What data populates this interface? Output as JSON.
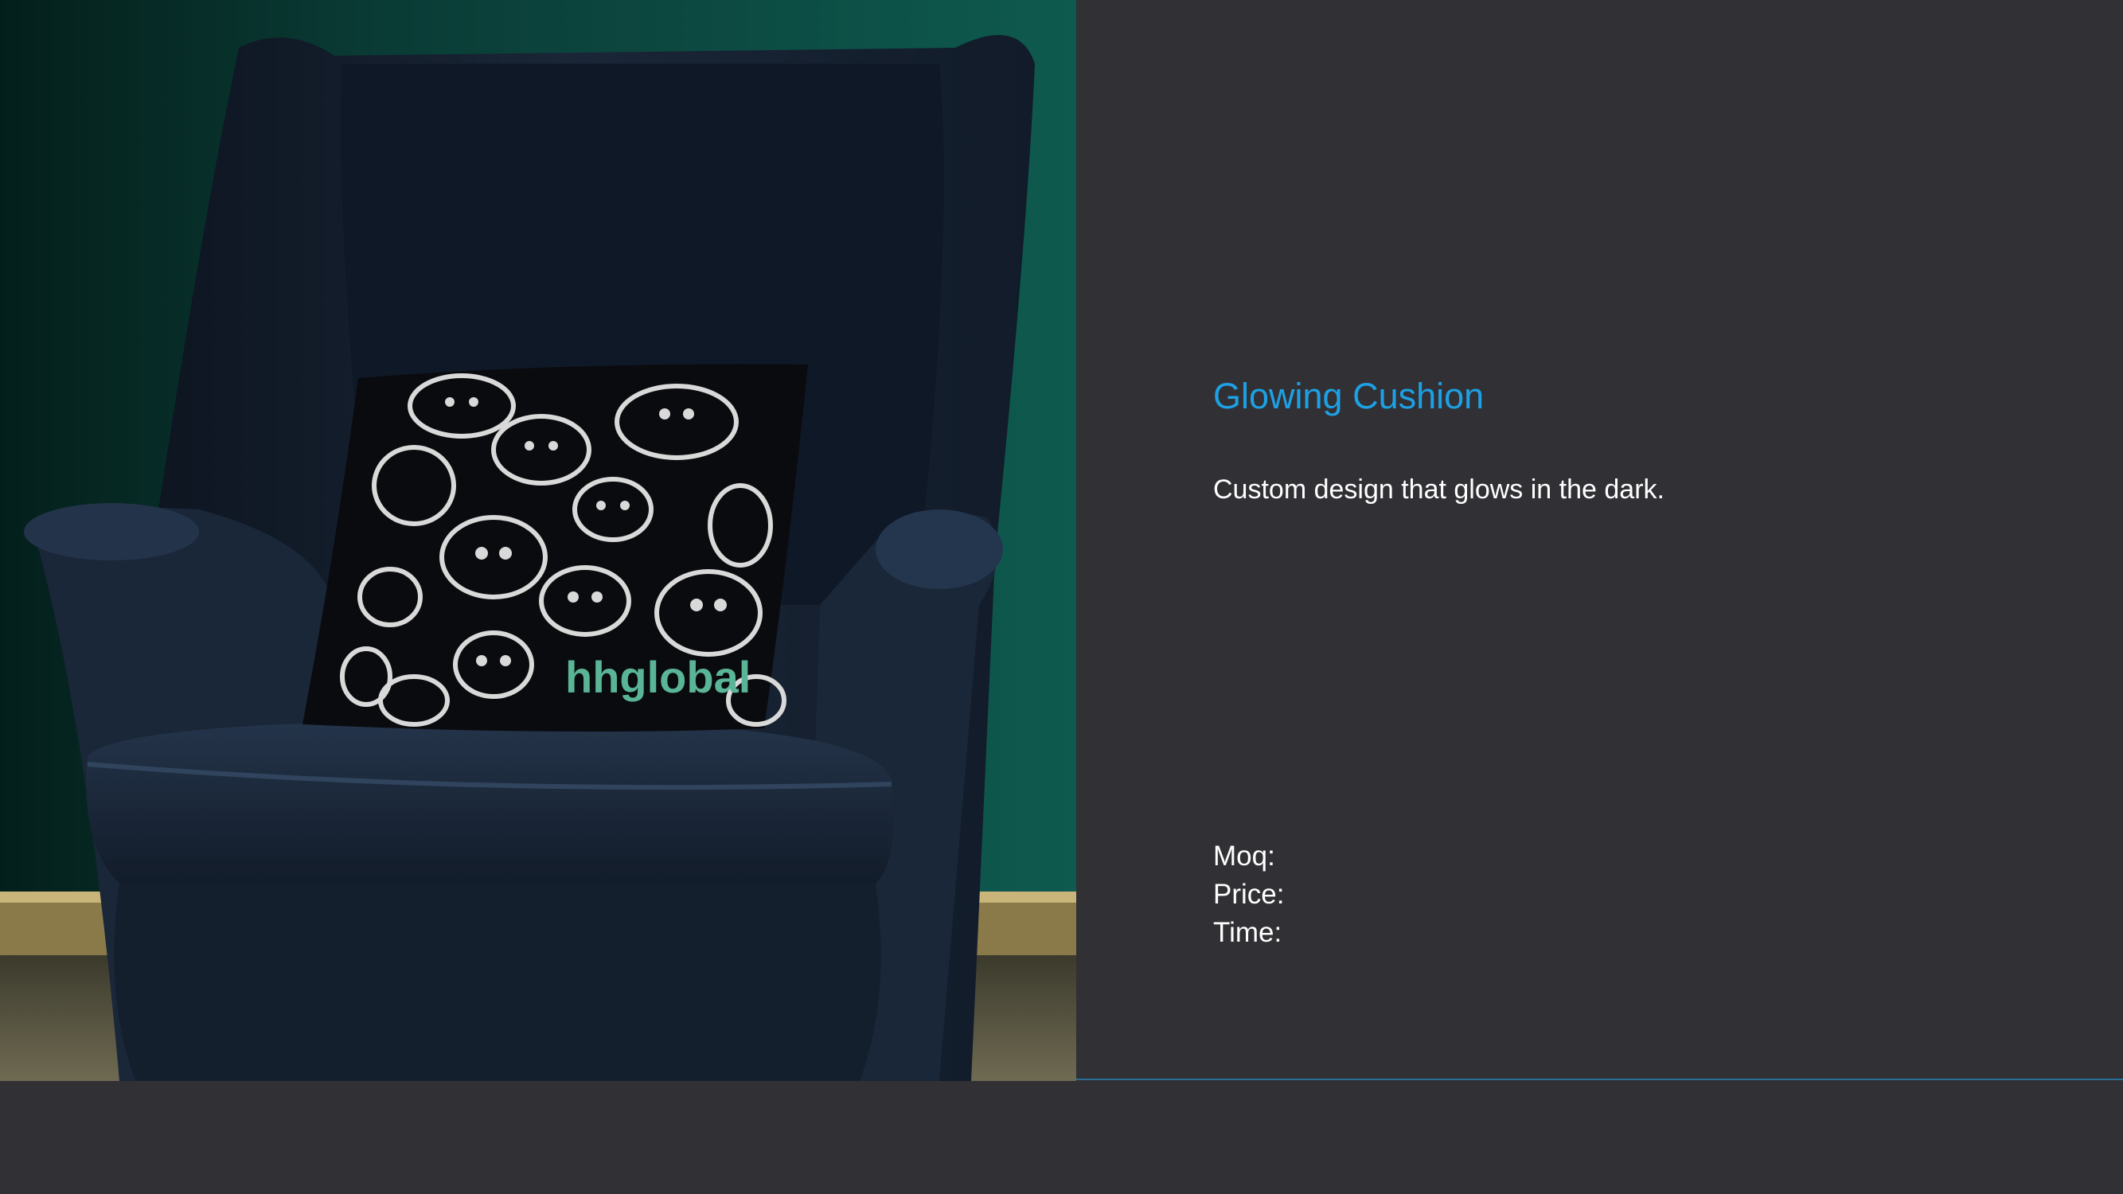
{
  "product": {
    "title": "Glowing Cushion",
    "description": "Custom design that glows in the dark.",
    "specs": [
      {
        "label": "Moq:"
      },
      {
        "label": "Price:"
      },
      {
        "label": "Time:"
      }
    ]
  },
  "photo": {
    "logo_text": "hhglobal",
    "description_icon": "armchair-with-pumpkin-cushion"
  },
  "colors": {
    "background": "#313034",
    "title": "#1da1e4",
    "text": "#ffffff",
    "divider": "#2a6f95",
    "wall": "#0c4a42",
    "chair": "#15202f",
    "logo": "#5ab596"
  }
}
